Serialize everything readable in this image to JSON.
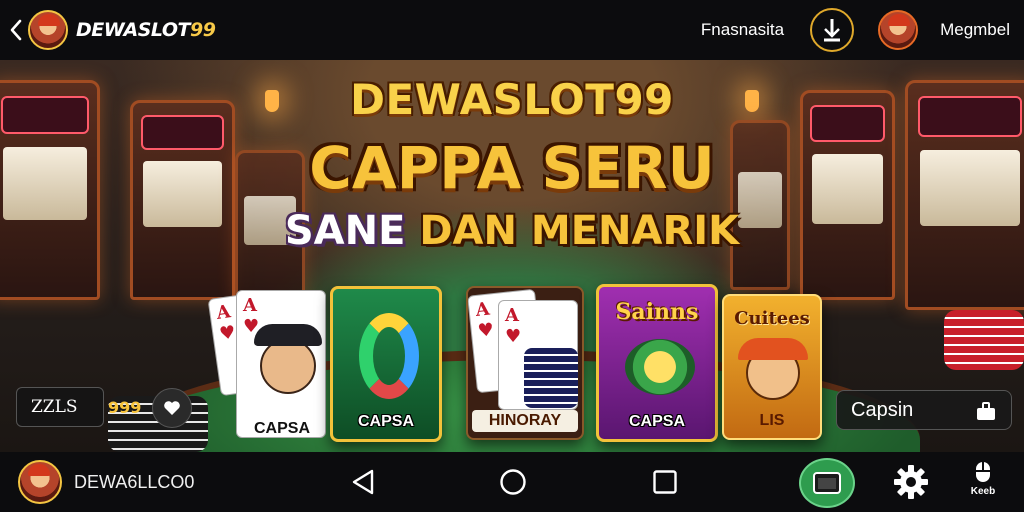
{
  "header": {
    "brand": "DEWASLOT",
    "brand_highlight": "99",
    "link_left": "Fnasnasita",
    "link_right": "Megmbel"
  },
  "banner": {
    "title_line1": "DEWASLOT99",
    "title_line2": "CAPPA SERU",
    "title_line3_white": "SANE",
    "title_line3_yellow": "DAN MENARIK",
    "cards": [
      {
        "label": "CAPSA"
      },
      {
        "label": "CAPSA"
      },
      {
        "label": "HINORAY"
      },
      {
        "title": "Sainns",
        "label": "CAPSA"
      },
      {
        "title": "Cuitees",
        "label": "LIS"
      }
    ],
    "side_chip_left": "ZZLS",
    "side_chip_left_count": "999",
    "side_chip_right": "Capsin"
  },
  "bottom_nav": {
    "user_label": "DEWA6LLCO0",
    "keeb_label": "Keeb"
  },
  "icons": {
    "back": "chevron-left-icon",
    "download": "download-icon",
    "heart": "heart-icon",
    "bag": "bag-icon",
    "nav_back": "triangle-back-icon",
    "nav_home": "circle-home-icon",
    "nav_recent": "square-recent-icon",
    "app": "app-window-icon",
    "settings": "gear-icon",
    "keeb": "keeb-icon"
  },
  "colors": {
    "accent_gold": "#f7c33b",
    "bar_bg": "#0c0c0e",
    "app_green": "#2e9c4e"
  }
}
